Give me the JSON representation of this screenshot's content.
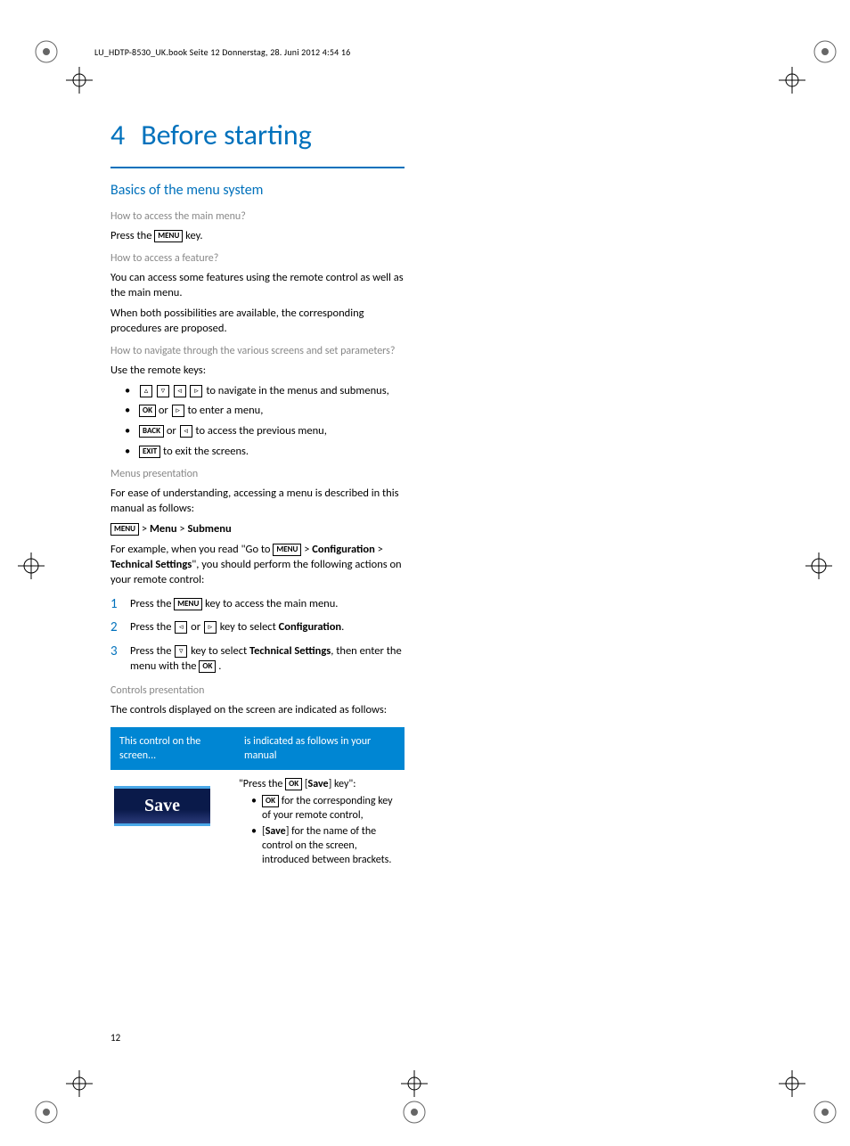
{
  "header_line": "LU_HDTP-8530_UK.book  Seite 12  Donnerstag, 28. Juni 2012  4:54 16",
  "chapter": {
    "number": "4",
    "title": "Before starting"
  },
  "section_title": "Basics of the menu system",
  "q1": "How to access the main menu?",
  "p1a": "Press the ",
  "p1b": " key.",
  "q2": "How to access a feature?",
  "p2": "You can access some features using the remote control as well as the main menu.",
  "p3": "When both possibilities are available, the corresponding procedures are proposed.",
  "q3": "How to navigate through the various screens and set parameters?",
  "p4": "Use the remote keys:",
  "nav_list": {
    "li1": " to navigate in the menus and submenus,",
    "li2_mid": "  or  ",
    "li2_end": "  to enter a menu,",
    "li3_mid": "  or  ",
    "li3_end": "  to access the previous menu,",
    "li4": "  to exit the screens."
  },
  "keys": {
    "menu": "MENU",
    "ok": "OK",
    "back": "BACK",
    "exit": "EXIT"
  },
  "q4": "Menus presentation",
  "p5": "For ease of understanding, accessing a menu is described in this manual as follows:",
  "p6_menu": "Menu",
  "p6_sub": "Submenu",
  "p7a": "For example, when you read \"Go to  ",
  "p7b": "  > ",
  "p7_conf": "Configuration",
  "p7c": " > ",
  "p7_tech": "Technical Settings",
  "p7d": "\", you should perform the following actions on your remote control:",
  "steps": {
    "s1a": "Press the  ",
    "s1b": "  key to access the main menu.",
    "s2a": "Press the  ",
    "s2_or": "  or  ",
    "s2b": "  key to select ",
    "s2_conf": "Configuration",
    "s2c": ".",
    "s3a": "Press the  ",
    "s3b": "  key to select ",
    "s3_tech": "Technical Settings",
    "s3c": ", then enter the menu with the  ",
    "s3d": " ."
  },
  "q5": "Controls presentation",
  "p8": "The controls displayed on the screen are indicated as follows:",
  "table": {
    "h1": "This control on the screen...",
    "h2": "is indicated as follows in your manual",
    "save_label": "Save",
    "c1a": "\"Press the ",
    "c1_save": "Save",
    "c1b": "] key\":",
    "li1a": " for the corresponding key of your remote control,",
    "li2a": "[",
    "li2_save": "Save",
    "li2b": "] for the name of the control on the screen, introduced between brackets."
  },
  "page_number": "12"
}
